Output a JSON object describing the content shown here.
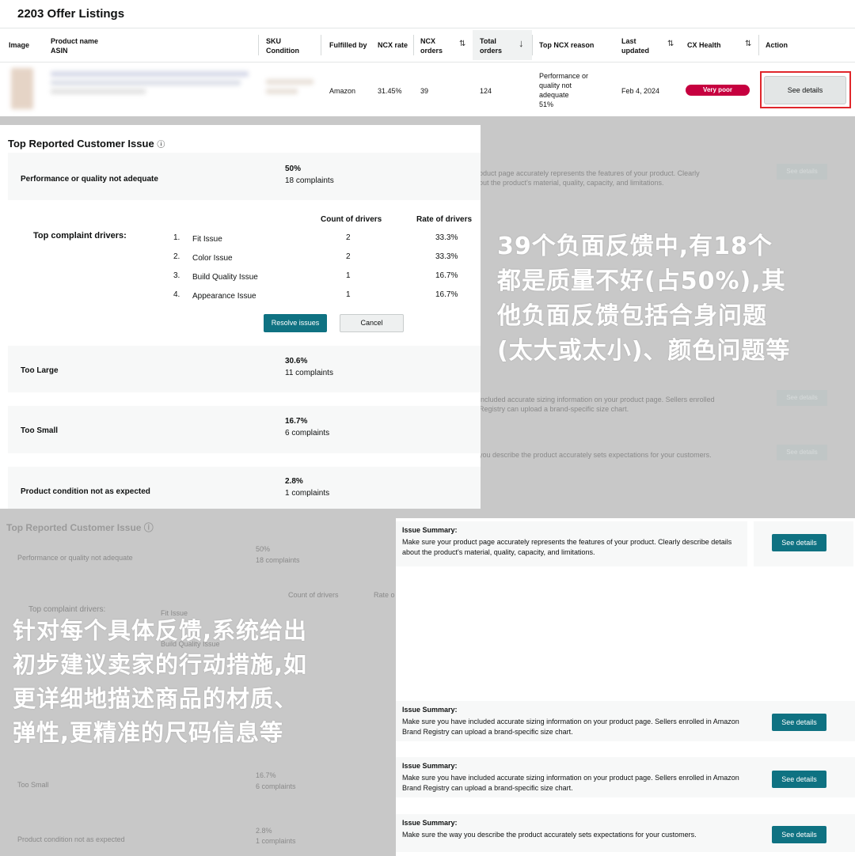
{
  "offers": {
    "title": "2203 Offer Listings",
    "columns": {
      "image": "Image",
      "product_name": "Product name",
      "asin": "ASIN",
      "sku": "SKU",
      "condition": "Condition",
      "fulfilled_by": "Fulfilled by",
      "ncx_rate": "NCX rate",
      "ncx": "NCX",
      "orders": "orders",
      "total": "Total",
      "top_ncx_reason": "Top NCX reason",
      "last": "Last",
      "updated": "updated",
      "cx_health": "CX Health",
      "action": "Action"
    },
    "row": {
      "fulfilled_by": "Amazon",
      "ncx_rate": "31.45%",
      "ncx_orders": "39",
      "total_orders": "124",
      "reason_1": "Performance or",
      "reason_2": "quality not",
      "reason_3": "adequate",
      "reason_4": "51%",
      "last_updated": "Feb 4, 2024",
      "cx_health": "Very poor",
      "action": "See details"
    }
  },
  "popup": {
    "title": "Top Reported Customer Issue",
    "issues": [
      {
        "label": "Performance or quality not adequate",
        "pct": "50%",
        "complaints": "18 complaints"
      },
      {
        "label": "Too Large",
        "pct": "30.6%",
        "complaints": "11 complaints"
      },
      {
        "label": "Too Small",
        "pct": "16.7%",
        "complaints": "6 complaints"
      },
      {
        "label": "Product condition not as expected",
        "pct": "2.8%",
        "complaints": "1 complaints"
      }
    ],
    "drivers_title": "Top complaint drivers:",
    "count_header": "Count of drivers",
    "rate_header": "Rate of drivers",
    "drivers": [
      {
        "num": "1.",
        "name": "Fit Issue",
        "count": "2",
        "rate": "33.3%"
      },
      {
        "num": "2.",
        "name": "Color Issue",
        "count": "2",
        "rate": "33.3%"
      },
      {
        "num": "3.",
        "name": "Build Quality Issue",
        "count": "1",
        "rate": "16.7%"
      },
      {
        "num": "4.",
        "name": "Appearance Issue",
        "count": "1",
        "rate": "16.7%"
      }
    ],
    "resolve": "Resolve issues",
    "cancel": "Cancel"
  },
  "background": {
    "title": "Top Reported Customer Issue",
    "rows": [
      {
        "label": "Performance or quality not adequate",
        "pct": "50%",
        "complaints": "18 complaints"
      },
      {
        "label": "Too Small",
        "pct": "16.7%",
        "complaints": "6 complaints"
      },
      {
        "label": "Product condition not as expected",
        "pct": "2.8%",
        "complaints": "1 complaints"
      }
    ],
    "drivers_title": "Top complaint drivers:",
    "count_header": "Count of drivers",
    "rate_header": "Rate o",
    "d1": "Fit Issue",
    "d3": "Build Quality Issue",
    "bg_text_1": "oduct page accurately represents the features of your product. Clearly",
    "bg_text_2": "out the product's material, quality, capacity, and limitations.",
    "bg_text_3": "included accurate sizing information on your product page. Sellers enrolled",
    "bg_text_4": "Registry can upload a brand-specific size chart.",
    "bg_text_5": "you describe the product accurately sets expectations for your customers.",
    "see_details": "See details"
  },
  "summaries": [
    {
      "title": "Issue Summary:",
      "text": "Make sure your product page accurately represents the features of your product. Clearly describe details about the product's material, quality, capacity, and limitations.",
      "button": "See details"
    },
    {
      "title": "Issue Summary:",
      "text": "Make sure you have included accurate sizing information on your product page. Sellers enrolled in Amazon Brand Registry can upload a brand-specific size chart.",
      "button": "See details"
    },
    {
      "title": "Issue Summary:",
      "text": "Make sure you have included accurate sizing information on your product page. Sellers enrolled in Amazon Brand Registry can upload a brand-specific size chart.",
      "button": "See details"
    },
    {
      "title": "Issue Summary:",
      "text": "Make sure the way you describe the product accurately sets expectations for your customers.",
      "button": "See details"
    }
  ],
  "annotations": {
    "right": [
      "39个负面反馈中,有18个",
      "都是质量不好(占50%),其",
      "他负面反馈包括合身问题",
      "(太大或太小)、颜色问题等"
    ],
    "left": [
      "针对每个具体反馈,系统给出",
      "初步建议卖家的行动措施,如",
      "更详细地描述商品的材质、",
      "弹性,更精准的尺码信息等"
    ]
  }
}
